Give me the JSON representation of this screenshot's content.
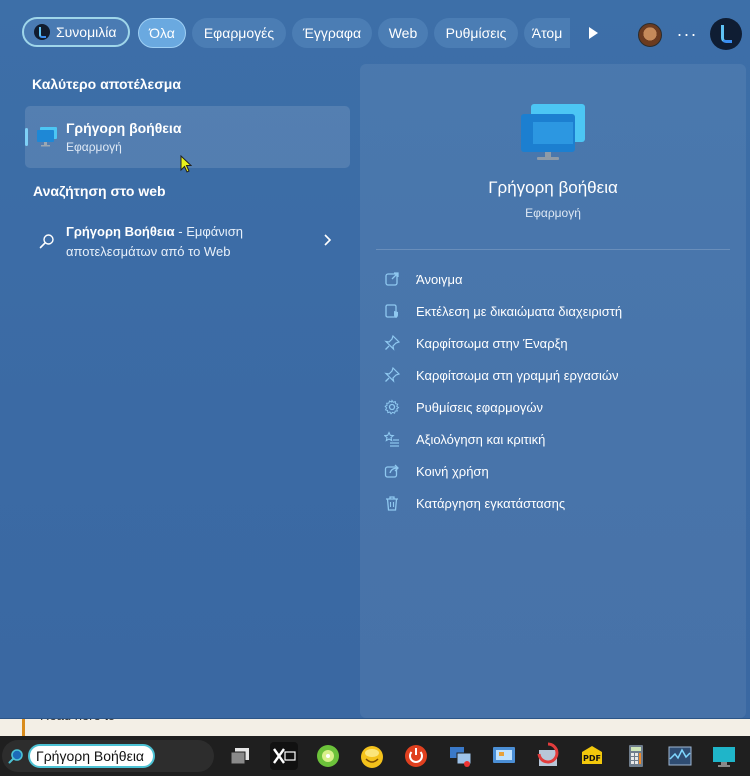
{
  "filters": {
    "chat": "Συνομιλία",
    "all": "Όλα",
    "apps": "Εφαρμογές",
    "documents": "Έγγραφα",
    "web": "Web",
    "settings": "Ρυθμίσεις",
    "people": "Άτομ"
  },
  "best_match": {
    "heading": "Καλύτερο αποτέλεσμα",
    "title": "Γρήγορη βοήθεια",
    "subtitle": "Εφαρμογή"
  },
  "web_search": {
    "heading": "Αναζήτηση στο web",
    "query": "Γρήγορη Βοήθεια",
    "suffix": " - Εμφάνιση αποτελεσμάτων από το Web"
  },
  "preview": {
    "title": "Γρήγορη βοήθεια",
    "subtitle": "Εφαρμογή",
    "actions": [
      {
        "label": "Άνοιγμα",
        "icon": "open-icon"
      },
      {
        "label": "Εκτέλεση με δικαιώματα διαχειριστή",
        "icon": "admin-shield-icon"
      },
      {
        "label": "Καρφίτσωμα στην Έναρξη",
        "icon": "pin-icon"
      },
      {
        "label": "Καρφίτσωμα στη γραμμή εργασιών",
        "icon": "pin-icon"
      },
      {
        "label": "Ρυθμίσεις εφαρμογών",
        "icon": "gear-icon"
      },
      {
        "label": "Αξιολόγηση και κριτική",
        "icon": "star-list-icon"
      },
      {
        "label": "Κοινή χρήση",
        "icon": "share-icon"
      },
      {
        "label": "Κατάργηση εγκατάστασης",
        "icon": "trash-icon"
      }
    ]
  },
  "background_doc": {
    "text": "Read here to "
  },
  "taskbar": {
    "search_value": "Γρήγορη Βοήθεια",
    "apps": [
      "task-view-icon",
      "x-app-icon",
      "kiwi-app-icon",
      "smiley-app-icon",
      "power-app-icon",
      "network-app-icon",
      "monitor-app-icon",
      "rollback-app-icon",
      "pdf-app-icon",
      "calculator-app-icon",
      "activity-monitor-app-icon",
      "display-app-icon"
    ]
  },
  "colors": {
    "panel_bg": "#3b6aa4",
    "accent": "#7fd0f7",
    "search_border": "#4cc2d4"
  }
}
